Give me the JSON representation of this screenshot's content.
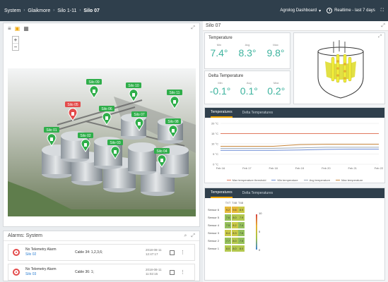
{
  "header": {
    "breadcrumb": [
      "System",
      "Glaikmore",
      "Silo 1-11",
      "Silo 07"
    ],
    "dashboard": "Agrolog Dashboard",
    "time": "Realtime - last 7 days"
  },
  "map": {
    "silos": [
      {
        "label": "Silo 01",
        "color": "#2fae4a"
      },
      {
        "label": "Silo 02",
        "color": "#2fae4a"
      },
      {
        "label": "Silo 03",
        "color": "#2fae4a"
      },
      {
        "label": "Silo 04",
        "color": "#2fae4a"
      },
      {
        "label": "Silo 05",
        "color": "#e34b4b"
      },
      {
        "label": "Silo 06",
        "color": "#2fae4a"
      },
      {
        "label": "Silo 07",
        "color": "#2fae4a"
      },
      {
        "label": "Silo 08",
        "color": "#2fae4a"
      },
      {
        "label": "Silo 09",
        "color": "#2fae4a"
      },
      {
        "label": "Silo 10",
        "color": "#2fae4a"
      },
      {
        "label": "Silo 11",
        "color": "#2fae4a"
      }
    ]
  },
  "alarms": {
    "title": "Alarms: System",
    "rows": [
      {
        "name": "No Telemetry Alarm",
        "silo": "Silo 02",
        "desc": "Cable 34: 1,2,3,6;",
        "date": "2018-08-11",
        "time": "12:47:17"
      },
      {
        "name": "No Telemetry Alarm",
        "silo": "Silo 03",
        "desc": "Cable 36: 1;",
        "date": "2018-08-11",
        "time": "11:02:15"
      }
    ]
  },
  "detail": {
    "title": "Silo 07",
    "temperature": {
      "title": "Temperature",
      "min_label": "Min",
      "avg_label": "Avg",
      "max_label": "Max",
      "min": "7.4°",
      "avg": "8.3°",
      "max": "9.8°"
    },
    "delta": {
      "title": "Delta Temperature",
      "min_label": "Min",
      "avg_label": "Avg",
      "max_label": "Max",
      "min": "-0.1°",
      "avg": "0.1°",
      "max": "0.2°"
    },
    "tabs1": [
      "Temperatures",
      "Delta Temperatures"
    ],
    "tabs2": [
      "Temperatures",
      "Delta Temperatures"
    ]
  },
  "chart_data": {
    "type": "line",
    "x": [
      "Feb 16",
      "Feb 17",
      "Feb 18",
      "Feb 19",
      "Feb 20",
      "Feb 21",
      "Feb 22"
    ],
    "y_ticks": [
      "20 °C",
      "15 °C",
      "10 °C",
      "5 °C",
      "0 °C"
    ],
    "ylim": [
      0,
      20
    ],
    "series": [
      {
        "name": "Max temperature threshold",
        "color": "#e07a5f",
        "values": [
          15,
          15,
          15,
          15,
          15,
          15,
          15
        ]
      },
      {
        "name": "Min temperature",
        "color": "#6c8cd5",
        "values": [
          6.8,
          6.8,
          6.8,
          7.0,
          7.3,
          7.4,
          7.4
        ]
      },
      {
        "name": "Avg temperature",
        "color": "#9aa7b5",
        "values": [
          7.8,
          7.8,
          7.8,
          8.0,
          8.3,
          8.3,
          8.3
        ]
      },
      {
        "name": "Max temperature",
        "color": "#c9873c",
        "values": [
          8.8,
          8.8,
          8.8,
          9.6,
          9.8,
          9.8,
          9.8
        ]
      }
    ]
  },
  "heatmap": {
    "columns": [
      "TXT",
      "T48",
      "T48"
    ],
    "rows": [
      {
        "label": "Sensor 6",
        "values": [
          "9.2",
          "9.6",
          "8.9"
        ]
      },
      {
        "label": "Sensor 5",
        "values": [
          "7.6",
          "8.0",
          "7.9"
        ]
      },
      {
        "label": "Sensor 4",
        "values": [
          "7.5",
          "8.2",
          "7.4"
        ]
      },
      {
        "label": "Sensor 3",
        "values": [
          "8.4",
          "8.3",
          "7.6"
        ]
      },
      {
        "label": "Sensor 2",
        "values": [
          "7.7",
          "8.0",
          "7.5"
        ]
      },
      {
        "label": "Sensor 1",
        "values": [
          "8.0",
          "8.0",
          "8.0"
        ]
      }
    ],
    "scale_max": "10",
    "scale_mid": "5",
    "scale_min": "0"
  }
}
